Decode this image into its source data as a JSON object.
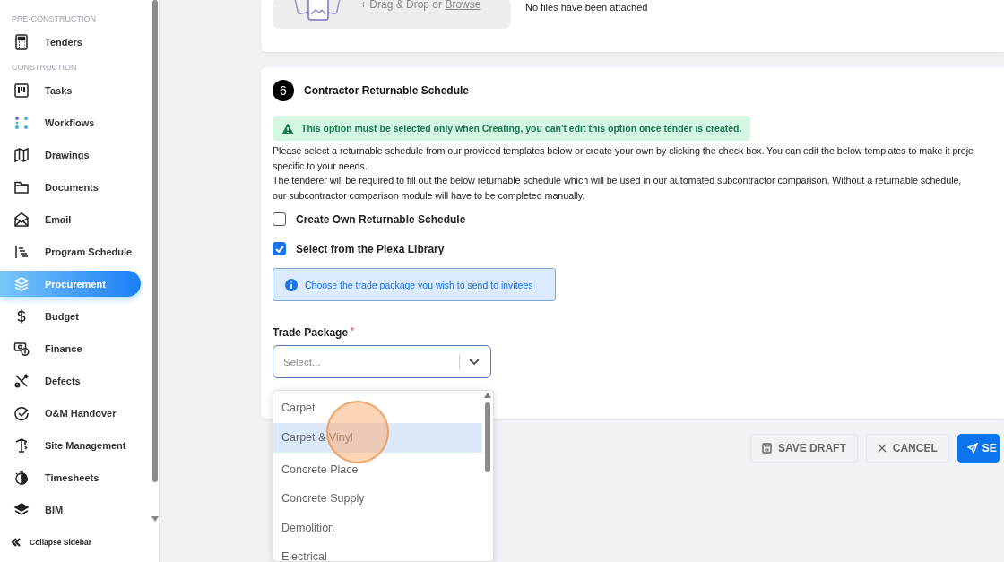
{
  "sidebar": {
    "sections": [
      {
        "label": "PRE-CONSTRUCTION",
        "items": [
          {
            "label": "Tenders",
            "selected": false
          }
        ]
      },
      {
        "label": "CONSTRUCTION",
        "items": [
          {
            "label": "Tasks",
            "selected": false
          },
          {
            "label": "Workflows",
            "selected": false
          },
          {
            "label": "Drawings",
            "selected": false
          },
          {
            "label": "Documents",
            "selected": false
          },
          {
            "label": "Email",
            "selected": false
          },
          {
            "label": "Program Schedule",
            "selected": false
          },
          {
            "label": "Procurement",
            "selected": true
          },
          {
            "label": "Budget",
            "selected": false
          },
          {
            "label": "Finance",
            "selected": false
          },
          {
            "label": "Defects",
            "selected": false
          },
          {
            "label": "O&M Handover",
            "selected": false
          },
          {
            "label": "Site Management",
            "selected": false
          },
          {
            "label": "Timesheets",
            "selected": false
          },
          {
            "label": "BIM",
            "selected": false
          }
        ]
      }
    ],
    "collapse": "Collapse Sidebar"
  },
  "upload": {
    "prompt": "+ Drag & Drop or",
    "link": "Browse",
    "status": "No files have been attached"
  },
  "section": {
    "number": "6",
    "title": "Contractor Returnable Schedule",
    "warning": "This option must be selected only when Creating, you can't edit this option once tender is created.",
    "paragraphs": [
      [
        "Please select a returnable schedule from our provided templates below or create your own by clicking the check box. You can edit the below templates to make it proje",
        "specific to your needs."
      ],
      [
        "The tenderer will be required to fill out the below returnable schedule which will be used in our automated subcontractor comparison. Without a returnable schedule,",
        "our subcontractor comparison module will have to be completed manually."
      ]
    ],
    "options": [
      {
        "label": "Create Own Returnable Schedule",
        "checked": false
      },
      {
        "label": "Select from the Plexa Library",
        "checked": true
      }
    ],
    "info": "Choose the trade package you wish to send to invitees",
    "field": {
      "label": "Trade Package",
      "required_mark": "*",
      "placeholder": "Select..."
    }
  },
  "dropdown": {
    "options": [
      {
        "label": "Carpet",
        "selected": false
      },
      {
        "label": "Carpet & Vinyl",
        "selected": true
      },
      {
        "label": "Concrete Place",
        "selected": false
      },
      {
        "label": "Concrete Supply",
        "selected": false
      },
      {
        "label": "Demolition",
        "selected": false
      },
      {
        "label": "Electrical",
        "selected": false
      }
    ]
  },
  "buttons": [
    {
      "label": "SAVE DRAFT",
      "kind": "secondary"
    },
    {
      "label": "CANCEL",
      "kind": "secondary"
    },
    {
      "label": "SE",
      "kind": "primary"
    }
  ]
}
